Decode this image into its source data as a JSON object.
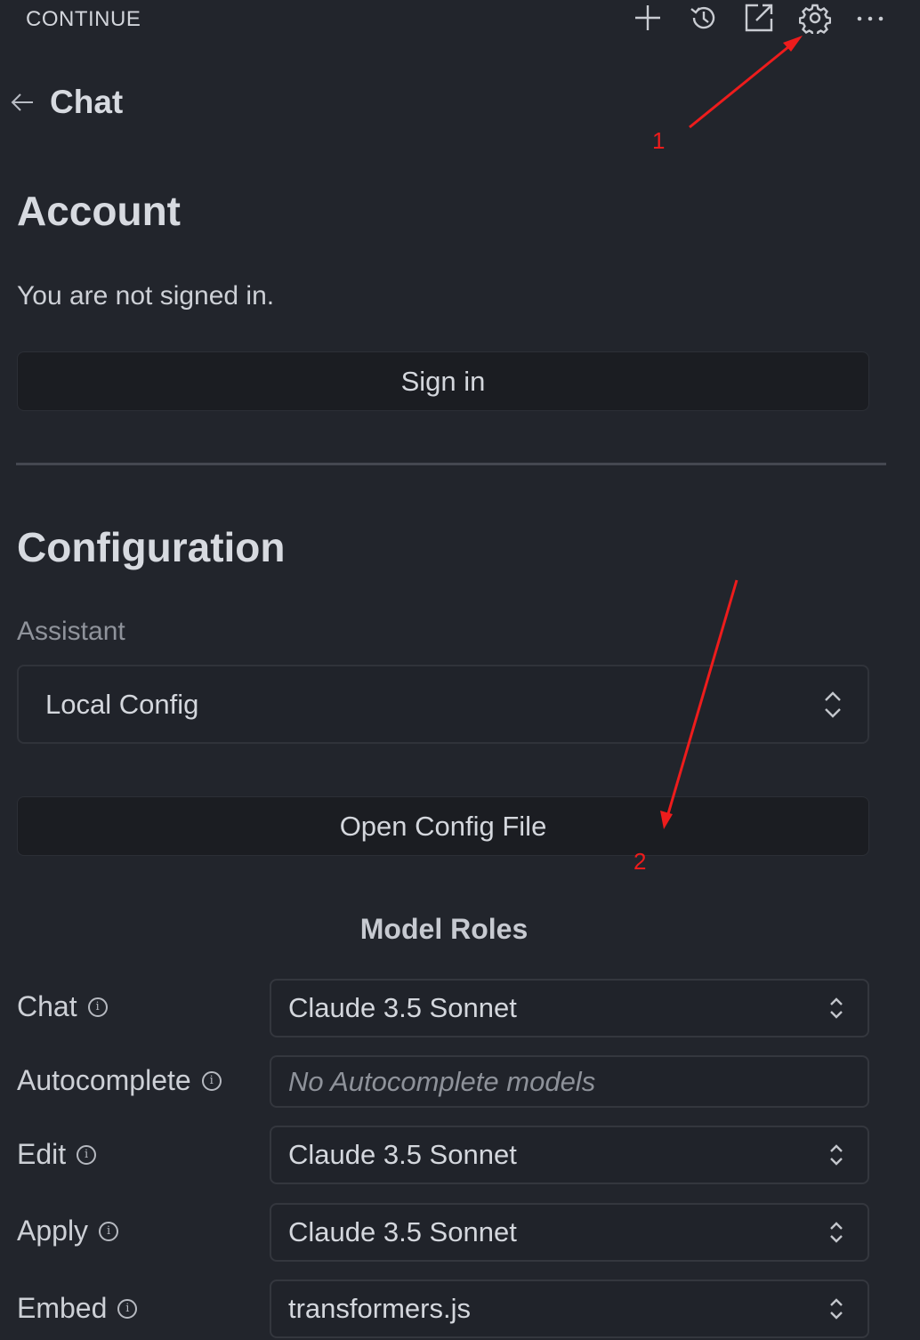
{
  "header": {
    "app_title": "CONTINUE",
    "icons": [
      "plus-icon",
      "history-icon",
      "open-external-icon",
      "gear-icon",
      "more-icon"
    ]
  },
  "nav": {
    "back_label": "Chat"
  },
  "account": {
    "title": "Account",
    "status": "You are not signed in.",
    "sign_in_label": "Sign in"
  },
  "configuration": {
    "title": "Configuration",
    "assistant_label": "Assistant",
    "assistant_value": "Local Config",
    "open_config_label": "Open Config File"
  },
  "model_roles": {
    "title": "Model Roles",
    "roles": [
      {
        "label": "Chat",
        "value": "Claude 3.5 Sonnet"
      },
      {
        "label": "Autocomplete",
        "value": "No Autocomplete models"
      },
      {
        "label": "Edit",
        "value": "Claude 3.5 Sonnet"
      },
      {
        "label": "Apply",
        "value": "Claude 3.5 Sonnet"
      },
      {
        "label": "Embed",
        "value": "transformers.js"
      }
    ]
  },
  "annotations": {
    "marker_1": "1",
    "marker_2": "2",
    "color": "#ee1c1c"
  },
  "colors": {
    "background": "#22252c",
    "button_bg": "#1b1d22"
  }
}
